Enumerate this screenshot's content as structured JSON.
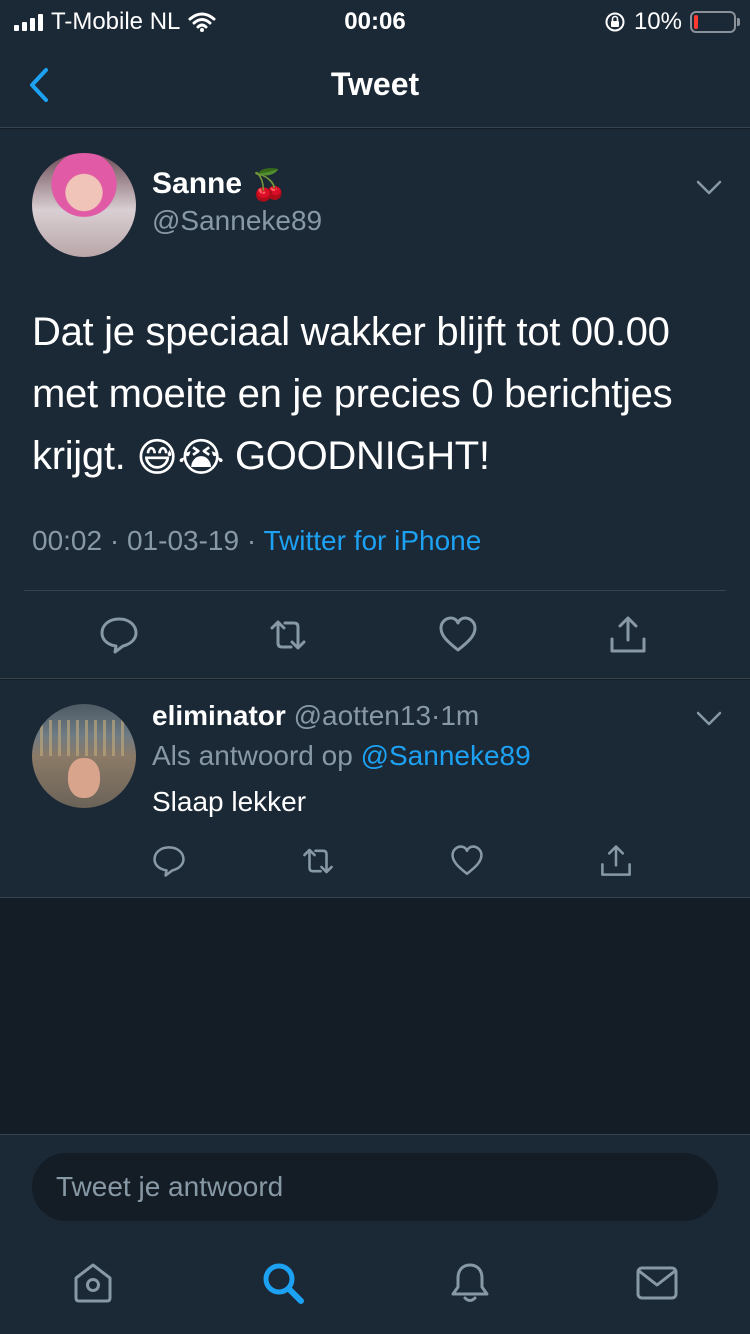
{
  "status_bar": {
    "carrier": "T-Mobile NL",
    "time": "00:06",
    "battery_percent": "10%",
    "battery_level": 0.1,
    "icons": [
      "signal-icon",
      "wifi-icon",
      "orientation-lock-icon",
      "battery-icon"
    ]
  },
  "nav": {
    "title": "Tweet",
    "back_icon": "chevron-left-icon"
  },
  "tweet": {
    "display_name": "Sanne",
    "name_emoji": "🍒",
    "handle": "@Sanneke89",
    "text_line1": "Dat je speciaal wakker blijft tot 00.00",
    "text_line2": "met moeite en je precies 0 berichtjes",
    "text_line3_prefix": "krijgt.",
    "text_line3_emojis": "😅😭",
    "text_line3_suffix": "GOODNIGHT!",
    "time": "00:02",
    "separator": "·",
    "date": "01-03-19",
    "source": "Twitter for iPhone",
    "actions": [
      "reply-icon",
      "retweet-icon",
      "like-icon",
      "share-icon"
    ]
  },
  "reply": {
    "display_name": "eliminator",
    "handle": "@aotten13",
    "separator": "·",
    "time": "1m",
    "reply_to_prefix": "Als antwoord op",
    "reply_to_handle": "@Sanneke89",
    "text": "Slaap lekker",
    "actions": [
      "reply-icon",
      "retweet-icon",
      "like-icon",
      "share-icon"
    ]
  },
  "composer": {
    "placeholder": "Tweet je antwoord"
  },
  "tab_bar": {
    "items": [
      "home-icon",
      "search-icon",
      "notifications-icon",
      "messages-icon"
    ],
    "active": "search-icon"
  },
  "colors": {
    "background": "#141d26",
    "surface": "#1b2836",
    "accent": "#1da1f2",
    "secondary_text": "#8899a6",
    "divider": "#38444d",
    "battery_low": "#ff3b30"
  }
}
